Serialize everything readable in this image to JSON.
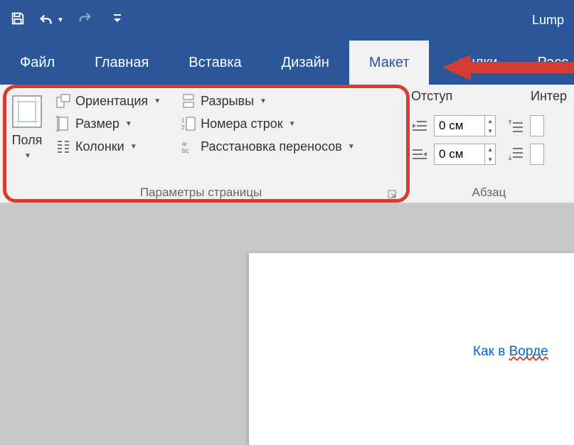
{
  "title": "Lump",
  "tabs": {
    "file": "Файл",
    "home": "Главная",
    "insert": "Вставка",
    "design": "Дизайн",
    "layout": "Макет",
    "references": "сылки",
    "mailings": "Расс"
  },
  "page_setup": {
    "margins": "Поля",
    "orientation": "Ориентация",
    "size": "Размер",
    "columns": "Колонки",
    "breaks": "Разрывы",
    "line_numbers": "Номера строк",
    "hyphenation": "Расстановка переносов",
    "group_label": "Параметры страницы"
  },
  "paragraph": {
    "indent_label": "Отступ",
    "spacing_label": "Интер",
    "indent_left": "0 см",
    "indent_right": "0 см",
    "spacing_before": "",
    "group_label": "Абзац"
  },
  "document": {
    "link_prefix": "Как в ",
    "link_err": "Ворде"
  }
}
